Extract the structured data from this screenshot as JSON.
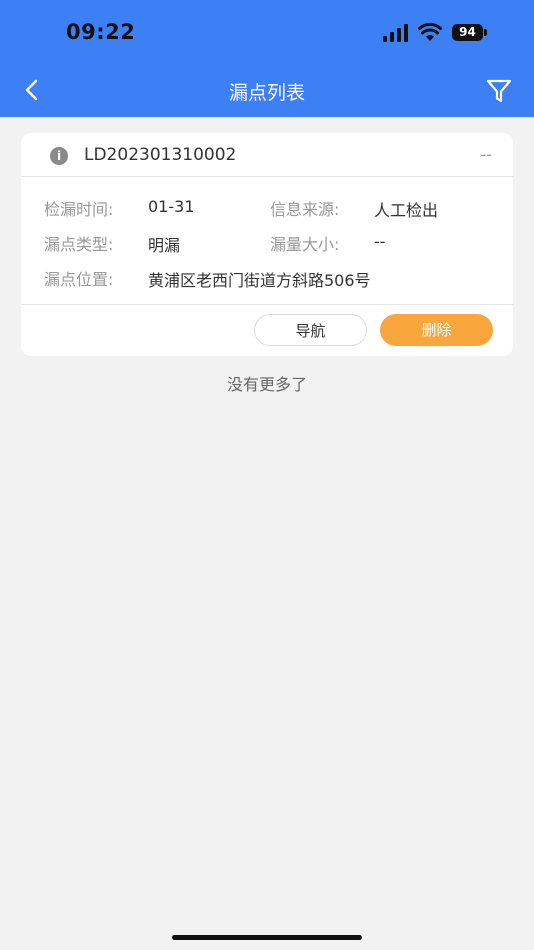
{
  "status_bar": {
    "time": "09:22",
    "battery": "94"
  },
  "nav": {
    "title": "漏点列表"
  },
  "card": {
    "id": "LD202301310002",
    "status": "--",
    "fields": {
      "detect_time_label": "检漏时间:",
      "detect_time_value": "01-31",
      "source_label": "信息来源:",
      "source_value": "人工检出",
      "type_label": "漏点类型:",
      "type_value": "明漏",
      "amount_label": "漏量大小:",
      "amount_value": "--",
      "location_label": "漏点位置:",
      "location_value": "黄浦区老西门街道方斜路506号"
    },
    "buttons": {
      "navigate": "导航",
      "delete": "删除"
    }
  },
  "list": {
    "end_text": "没有更多了"
  },
  "colors": {
    "header": "#3d7ff5",
    "delete_button": "#f9a63c",
    "background": "#f2f2f2"
  }
}
